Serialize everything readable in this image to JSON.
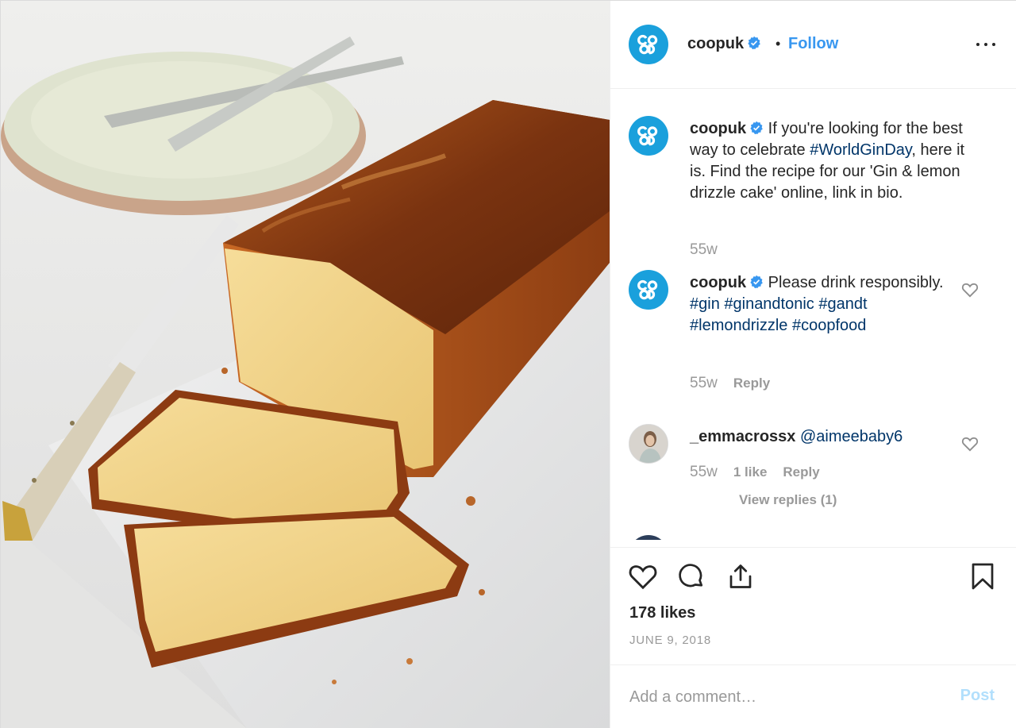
{
  "post": {
    "author": "coopuk",
    "separator": "•",
    "follow_label": "Follow"
  },
  "comments": [
    {
      "user": "coopuk",
      "text_1": " If you're looking for the best way to celebrate ",
      "hashtag": "#WorldGinDay",
      "text_2": ", here it is. Find the recipe for our 'Gin & lemon drizzle cake' online, link in bio.",
      "age": "55w"
    },
    {
      "user": "coopuk",
      "text": " Please drink responsibly. ",
      "hashtags": [
        "#gin",
        "#ginandtonic",
        "#gandt",
        "#lemondrizzle",
        "#coopfood"
      ],
      "age": "55w",
      "reply_label": "Reply"
    },
    {
      "user": "_emmacrossx",
      "mention": "@aimeebaby6",
      "age": "55w",
      "likes_label": "1 like",
      "reply_label": "Reply",
      "view_replies_label": "View replies (1)"
    }
  ],
  "footer": {
    "likes": "178 likes",
    "date": "JUNE 9, 2018",
    "comment_placeholder": "Add a comment…",
    "post_label": "Post"
  },
  "colors": {
    "brand_blue": "#1aa0dc",
    "link": "#3897f0",
    "hashtag": "#003569",
    "muted": "#999999"
  },
  "icons": {
    "header": [
      "coop-logo-icon",
      "verified-badge-icon",
      "more-options-icon"
    ],
    "actions": [
      "heart-icon",
      "comment-icon",
      "share-icon",
      "bookmark-icon"
    ]
  }
}
